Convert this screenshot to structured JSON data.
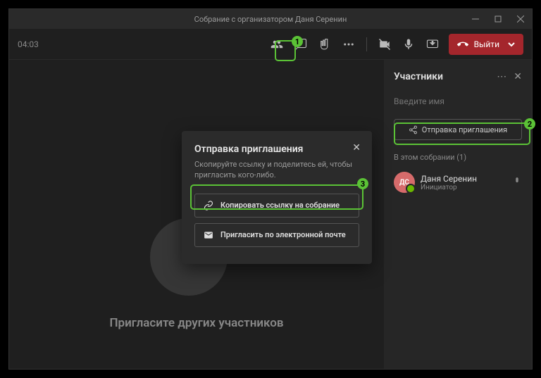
{
  "window": {
    "title": "Собрание с организатором Даня Серенин"
  },
  "toolbar": {
    "timer": "04:03"
  },
  "leave": {
    "label": "Выйти"
  },
  "stage": {
    "invite": "Пригласите других участников"
  },
  "panel": {
    "title": "Участники",
    "search_placeholder": "Введите имя",
    "share": "Отправка приглашения",
    "section": "В этом собрании (1)",
    "participant": {
      "initials": "ДС",
      "name": "Даня Серенин",
      "role": "Инициатор"
    }
  },
  "modal": {
    "title": "Отправка приглашения",
    "subtitle": "Скопируйте ссылку и поделитесь ей, чтобы пригласить кого-либо.",
    "copy": "Копировать ссылку на собрание",
    "email": "Пригласить по электронной почте"
  },
  "badges": {
    "b1": "1",
    "b2": "2",
    "b3": "3"
  }
}
